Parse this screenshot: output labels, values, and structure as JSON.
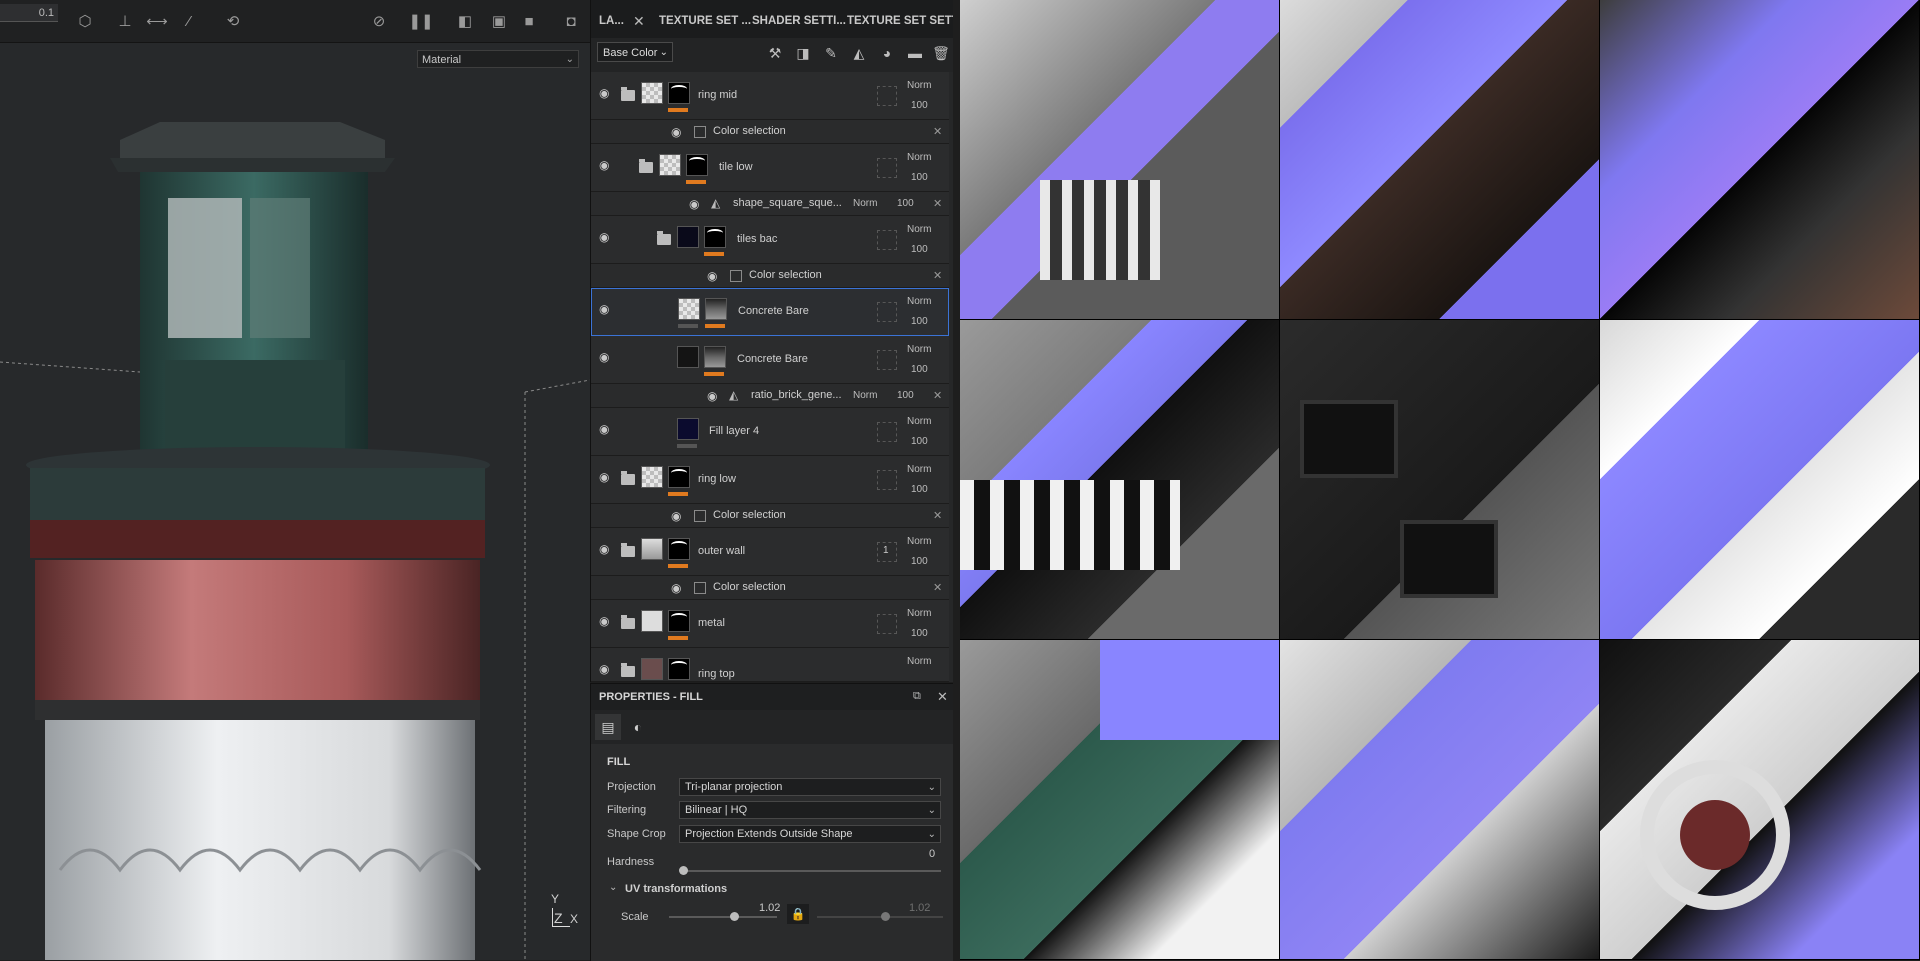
{
  "toolbar": {
    "value_field": "0.1",
    "material_select": "Material"
  },
  "tabs": {
    "layers": "LA...",
    "texture_set_1": "TEXTURE SET ...",
    "shader_settings": "SHADER SETTI...",
    "texture_set_2": "TEXTURE SET SETTI..."
  },
  "layer_toolbar": {
    "channel": "Base Color"
  },
  "layers": [
    {
      "name": "ring mid",
      "blend": "Norm",
      "opacity": "100"
    },
    {
      "name": "Color selection"
    },
    {
      "name": "tile low",
      "blend": "Norm",
      "opacity": "100"
    },
    {
      "name": "shape_square_sque...",
      "blend": "Norm",
      "opacity": "100"
    },
    {
      "name": "tiles bac",
      "blend": "Norm",
      "opacity": "100"
    },
    {
      "name": "Color selection"
    },
    {
      "name": "Concrete Bare",
      "blend": "Norm",
      "opacity": "100"
    },
    {
      "name": "Concrete Bare",
      "blend": "Norm",
      "opacity": "100"
    },
    {
      "name": "ratio_brick_gene...",
      "blend": "Norm",
      "opacity": "100"
    },
    {
      "name": "Fill layer 4",
      "blend": "Norm",
      "opacity": "100"
    },
    {
      "name": "ring low",
      "blend": "Norm",
      "opacity": "100"
    },
    {
      "name": "Color selection"
    },
    {
      "name": "outer wall",
      "blend": "Norm",
      "opacity": "100",
      "badge": "1"
    },
    {
      "name": "Color selection"
    },
    {
      "name": "metal",
      "blend": "Norm",
      "opacity": "100"
    },
    {
      "name": "ring top",
      "blend": "Norm"
    }
  ],
  "properties": {
    "title": "PROPERTIES - FILL",
    "section": "FILL",
    "projection_label": "Projection",
    "projection_value": "Tri-planar projection",
    "filtering_label": "Filtering",
    "filtering_value": "Bilinear | HQ",
    "shape_crop_label": "Shape Crop",
    "shape_crop_value": "Projection Extends Outside Shape",
    "hardness_label": "Hardness",
    "hardness_value": "0",
    "uv_section": "UV transformations",
    "scale_label": "Scale",
    "scale_value": "1.02",
    "scale_value_2": "1.02"
  },
  "axis_gizmo": {
    "y": "Y",
    "z": "Z",
    "x": "X"
  }
}
